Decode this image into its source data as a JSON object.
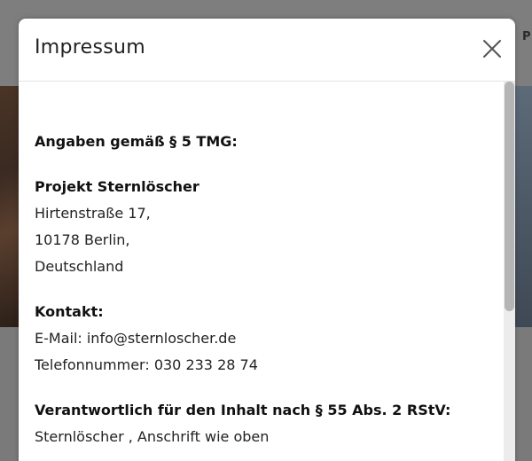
{
  "background": {
    "peek_text": "P"
  },
  "modal": {
    "title": "Impressum",
    "close_icon": "close-icon",
    "content": {
      "heading_tmg": "Angaben gemäß § 5 TMG:",
      "company_name": "Projekt Sternlöscher",
      "address_street": "Hirtenstraße 17,",
      "address_city": "10178 Berlin,",
      "address_country": "Deutschland",
      "contact_heading": "Kontakt:",
      "email_line": "E-Mail: info@sternloscher.de",
      "phone_line": "Telefonnummer: 030 233 28 74",
      "responsible_heading": "Verantwortlich für den Inhalt nach § 55 Abs. 2 RStV:",
      "responsible_text": "Sternlöscher , Anschrift wie oben"
    }
  },
  "colors": {
    "overlay": "#777777",
    "modal_bg": "#ffffff",
    "text": "#222222",
    "scroll_thumb": "#b5b5b5"
  }
}
